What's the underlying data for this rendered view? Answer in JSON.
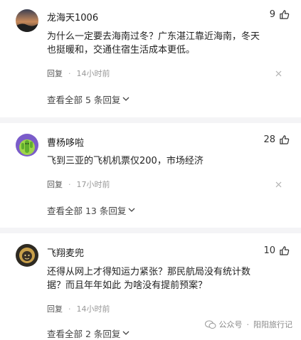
{
  "comments": [
    {
      "username": "龙海天1006",
      "likes": "9",
      "text_lines": [
        "为什么一定要去海南过冬？广东湛江靠近海南，冬天",
        "也挺暖和，交通住宿生活成本更低。"
      ],
      "reply_label": "回复",
      "time": "14小时前",
      "view_all": "查看全部 5 条回复"
    },
    {
      "username": "曹杨哆啦",
      "likes": "28",
      "text_lines": [
        "飞到三亚的飞机机票仅200，市场经济"
      ],
      "reply_label": "回复",
      "time": "17小时前",
      "view_all": "查看全部 13 条回复"
    },
    {
      "username": "飞翔麦兜",
      "likes": "10",
      "text_lines": [
        "还得从网上才得知运力紧张？那民航局没有统计数",
        "据？而且年年如此 为啥没有提前预案？"
      ],
      "reply_label": "回复",
      "time": "14小时前",
      "view_all": "查看全部 2 条回复"
    }
  ],
  "watermark": {
    "source": "公众号",
    "author": "阳阳旅行记"
  },
  "icons": {
    "like": "thumbs-up-icon",
    "close": "close-icon",
    "chevron": "chevron-down-icon",
    "wechat": "wechat-icon"
  },
  "colors": {
    "separator": "#f4f4f6",
    "muted_text": "#999999"
  }
}
